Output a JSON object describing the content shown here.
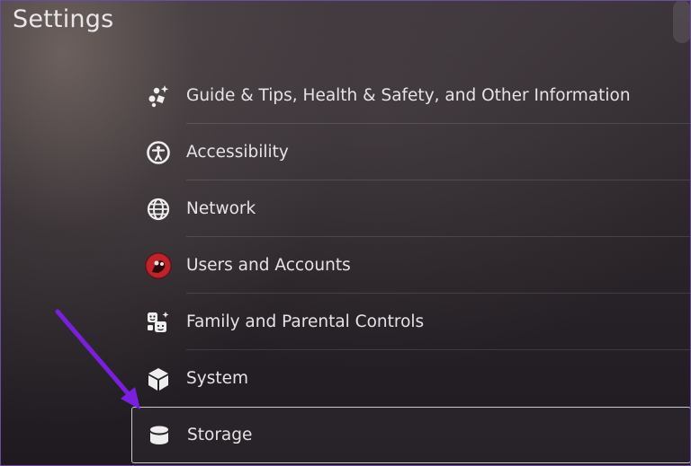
{
  "header": {
    "title": "Settings"
  },
  "menu": {
    "items": [
      {
        "label": "Guide & Tips, Health & Safety, and Other Information",
        "icon": "guide-tips-icon"
      },
      {
        "label": "Accessibility",
        "icon": "accessibility-icon"
      },
      {
        "label": "Network",
        "icon": "globe-icon"
      },
      {
        "label": "Users and Accounts",
        "icon": "user-avatar-icon"
      },
      {
        "label": "Family and Parental Controls",
        "icon": "family-icon"
      },
      {
        "label": "System",
        "icon": "cube-icon"
      },
      {
        "label": "Storage",
        "icon": "storage-icon"
      }
    ],
    "selected_index": 6
  },
  "colors": {
    "annotation_arrow": "#7a1fe0",
    "text": "#e6e3e6",
    "frame": "#6d4aa8"
  }
}
